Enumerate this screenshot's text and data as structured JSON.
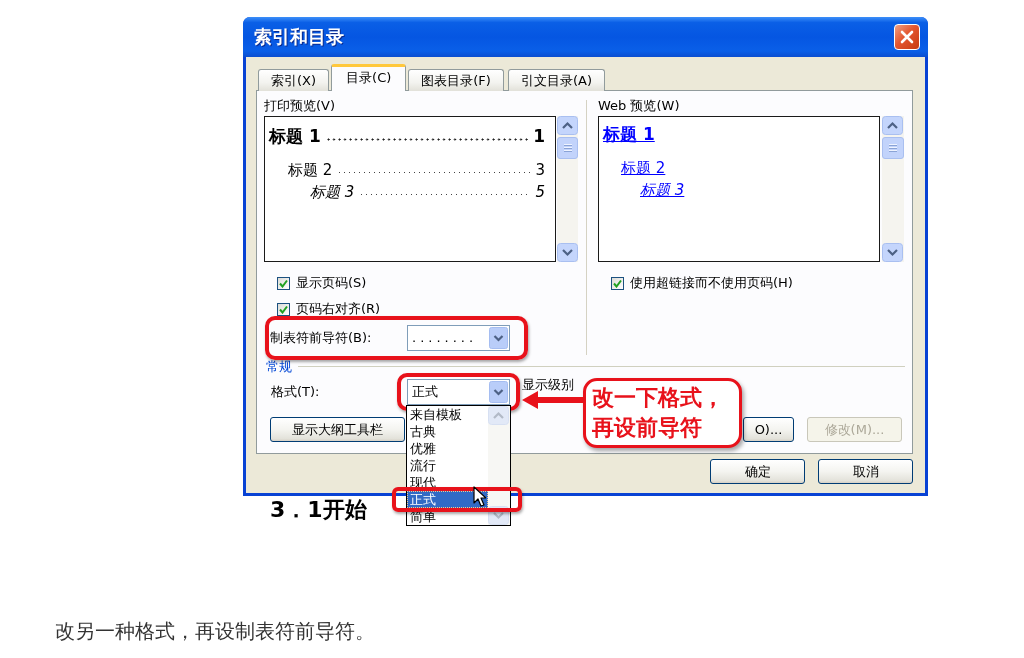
{
  "dialog": {
    "title": "索引和目录",
    "tabs": [
      {
        "label": "索引(X)",
        "selected": false
      },
      {
        "label": "目录(C)",
        "selected": true
      },
      {
        "label": "图表目录(F)",
        "selected": false
      },
      {
        "label": "引文目录(A)",
        "selected": false
      }
    ],
    "print_preview": {
      "label": "打印预览(V)",
      "entries": [
        {
          "text": "标题 1",
          "page": "1",
          "children": [
            {
              "text": "标题 2",
              "page": "3",
              "children": [
                {
                  "text": "标题 3",
                  "page": "5"
                }
              ]
            }
          ]
        }
      ]
    },
    "print_options": [
      {
        "label": "显示页码(S)",
        "checked": true
      },
      {
        "label": "页码右对齐(R)",
        "checked": true
      }
    ],
    "tab_leader": {
      "label": "制表符前导符(B):",
      "value": "........",
      "highlighted": true
    },
    "web_preview": {
      "label": "Web 预览(W)",
      "entries": [
        {
          "text": "标题 1",
          "children": [
            {
              "text": "标题 2",
              "children": [
                {
                  "text": "标题 3"
                }
              ]
            }
          ]
        }
      ]
    },
    "web_options": [
      {
        "label": "使用超链接而不使用页码(H)",
        "checked": true
      }
    ],
    "general": {
      "label": "常规",
      "format": {
        "label": "格式(T):",
        "value": "正式",
        "highlighted": true,
        "expanded": true,
        "options": [
          {
            "text": "来自模板",
            "selected": false,
            "highlighted": false
          },
          {
            "text": "古典",
            "selected": false,
            "highlighted": false
          },
          {
            "text": "优雅",
            "selected": false,
            "highlighted": false
          },
          {
            "text": "流行",
            "selected": false,
            "highlighted": false
          },
          {
            "text": "现代",
            "selected": false,
            "highlighted": false
          },
          {
            "text": "正式",
            "selected": true,
            "highlighted": true
          },
          {
            "text": "简单",
            "selected": false,
            "highlighted": false
          }
        ]
      },
      "show_levels_label": "显示级别",
      "buttons": [
        {
          "label": "显示大纲工具栏",
          "disabled": false
        },
        {
          "label": "O)...",
          "disabled": false
        },
        {
          "label": "修改(M)...",
          "disabled": true
        }
      ]
    },
    "footer_buttons": [
      "确定",
      "取消"
    ]
  },
  "callout": {
    "text": "改一下格式，再设前导符"
  },
  "next_heading": "3．1开始",
  "caption": "改另一种格式，再设制表符前导符。"
}
